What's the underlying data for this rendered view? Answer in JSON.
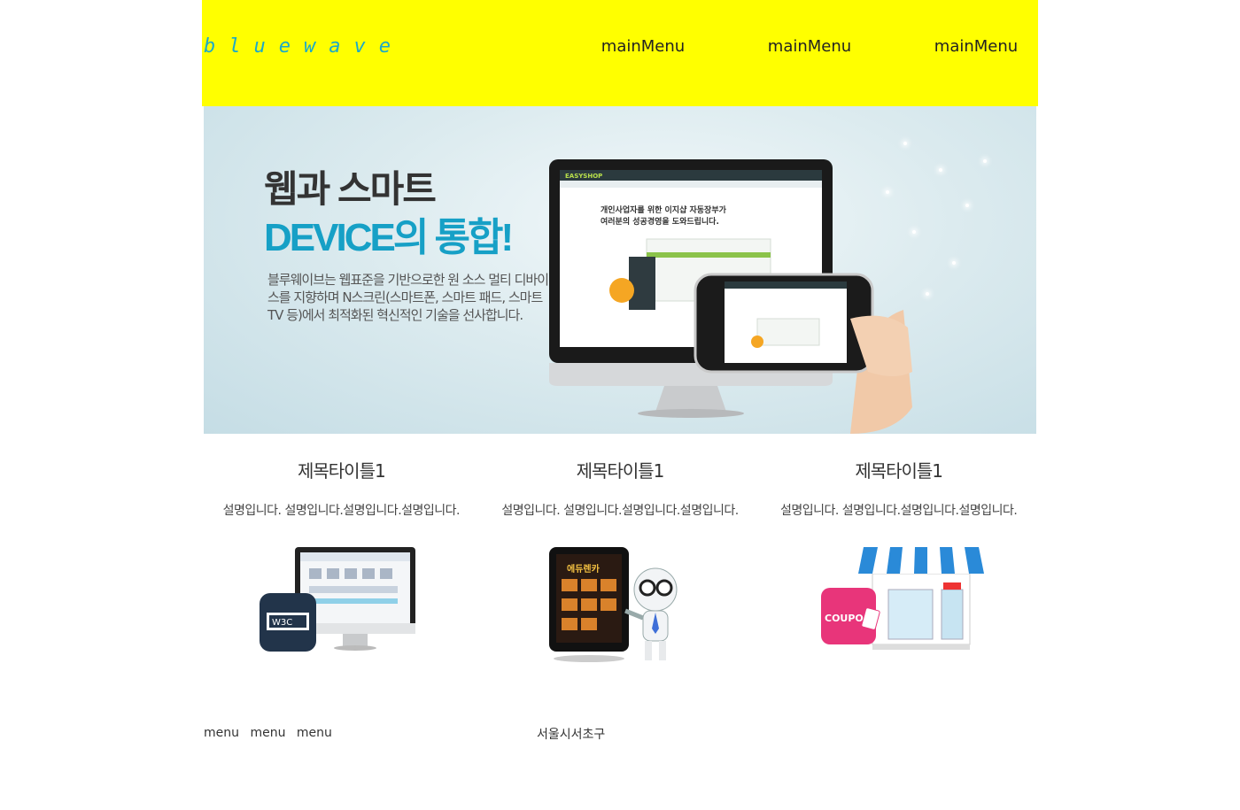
{
  "header": {
    "logo": "bluewave",
    "nav": [
      "mainMenu",
      "mainMenu",
      "mainMenu"
    ]
  },
  "hero": {
    "title_line1": "웹과 스마트",
    "title_line2": "DEVICE의 통합!",
    "description": "블루웨이브는 웹표준을 기반으로한 원 소스 멀티 디바이스를 지향하며 N스크린(스마트폰, 스마트 패드, 스마트TV 등)에서 최적화된 혁신적인 기술을 선사합니다.",
    "monitor_brand": "EASYSHOP",
    "monitor_headline1": "개인사업자를 위한 이지샵 자동장부가",
    "monitor_headline2": "여러분의 성공경영을 도와드립니다."
  },
  "features": [
    {
      "title": "제목타이틀1",
      "desc": "설명입니다. 설명입니다.설명입니다.설명입니다.",
      "icon": "w3c-monitor-icon",
      "badge": "W3C"
    },
    {
      "title": "제목타이틀1",
      "desc": "설명입니다. 설명입니다.설명입니다.설명입니다.",
      "icon": "tablet-character-icon",
      "badge": "에듀렌카"
    },
    {
      "title": "제목타이틀1",
      "desc": "설명입니다. 설명입니다.설명입니다.설명입니다.",
      "icon": "shop-coupon-icon",
      "badge": "COUPON"
    }
  ],
  "footer": {
    "menu": [
      "menu",
      "menu",
      "menu"
    ],
    "address": "서울시서초구"
  },
  "colors": {
    "header_bg": "#ffff00",
    "accent": "#16a0c6"
  }
}
